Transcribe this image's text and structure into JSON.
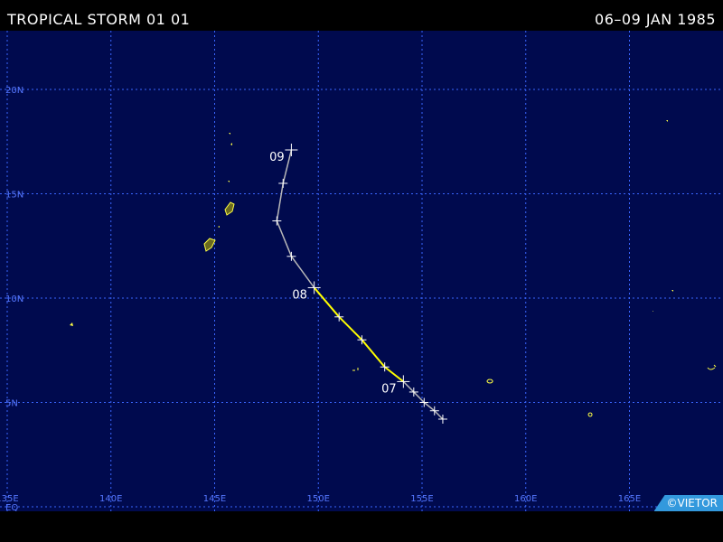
{
  "header": {
    "title": "TROPICAL STORM 01 01",
    "dates": "06–09 JAN 1985"
  },
  "credit": "©VIETOR",
  "map": {
    "lon_range": [
      135,
      170
    ],
    "lat_range": [
      -0.5,
      22
    ],
    "lat_labels": [
      {
        "lat": 20,
        "label": "20N"
      },
      {
        "lat": 15,
        "label": "15N"
      },
      {
        "lat": 10,
        "label": "10N"
      },
      {
        "lat": 5,
        "label": "5N"
      },
      {
        "lat": 0,
        "label": "EQ"
      }
    ],
    "lon_labels": [
      {
        "lon": 135,
        "label": "135E"
      },
      {
        "lon": 140,
        "label": "140E"
      },
      {
        "lon": 145,
        "label": "145E"
      },
      {
        "lon": 150,
        "label": "150E"
      },
      {
        "lon": 155,
        "label": "155E"
      },
      {
        "lon": 160,
        "label": "160E"
      },
      {
        "lon": 165,
        "label": "165E"
      }
    ],
    "colors": {
      "ocean": "#000a4e",
      "grid": "#3a66ff",
      "track_weak": "#b8b8b8",
      "track_storm": "#ffff00",
      "land": "#6b6b1e",
      "coast": "#ffff44"
    }
  },
  "track": [
    {
      "lon": 156.0,
      "lat": 4.2
    },
    {
      "lon": 155.6,
      "lat": 4.6
    },
    {
      "lon": 155.1,
      "lat": 5.0
    },
    {
      "lon": 154.6,
      "lat": 5.5
    },
    {
      "lon": 154.1,
      "lat": 6.0,
      "day_label": "07"
    },
    {
      "lon": 153.2,
      "lat": 6.7
    },
    {
      "lon": 152.1,
      "lat": 8.0
    },
    {
      "lon": 151.0,
      "lat": 9.1
    },
    {
      "lon": 149.8,
      "lat": 10.5,
      "day_label": "08"
    },
    {
      "lon": 148.7,
      "lat": 12.0
    },
    {
      "lon": 148.0,
      "lat": 13.7
    },
    {
      "lon": 148.3,
      "lat": 15.5
    },
    {
      "lon": 148.7,
      "lat": 17.1,
      "day_label": "09"
    }
  ],
  "storm_segment": [
    8,
    4
  ]
}
